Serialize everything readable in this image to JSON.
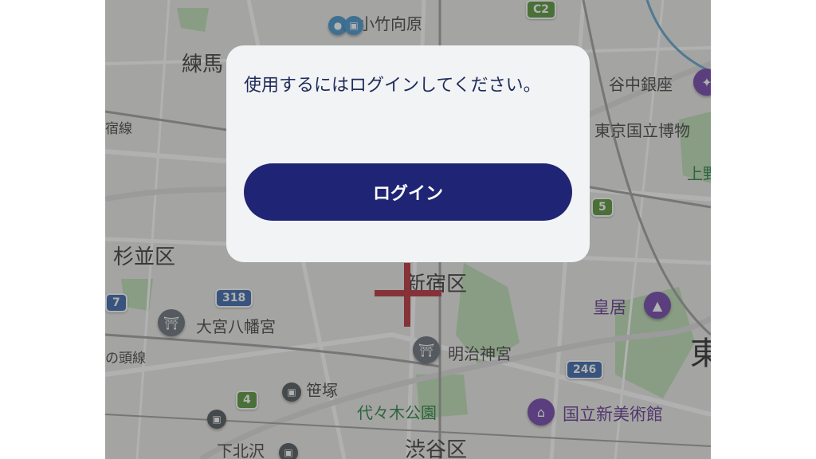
{
  "dialog": {
    "message": "使用するにはログインしてください。",
    "login_button": "ログイン"
  },
  "map": {
    "labels": {
      "kotake": "小竹向原",
      "nerima": "練馬",
      "yanaka": "谷中銀座",
      "tokyo_museum": "東京国立博物",
      "ueno": "上野",
      "line_left": "宿線",
      "suginami": "杉並区",
      "shinjuku": "新宿区",
      "omiya": "大宮八幡宮",
      "kokyo": "皇居",
      "meiji": "明治神宮",
      "higashi": "東",
      "kashira": "の頭線",
      "sasazuka": "笹塚",
      "yoyogi": "代々木公園",
      "kokuritsu": "国立新美術館",
      "shimokita": "下北沢",
      "shibuya": "渋谷区"
    },
    "shields": {
      "c2": "C2",
      "r5": "5",
      "r318": "318",
      "r7": "7",
      "r246": "246",
      "r4": "4"
    }
  },
  "colors": {
    "dialog_bg": "#f1f3f4",
    "button_bg": "#1f2574",
    "message_text": "#1f2a5a",
    "crosshair": "#b3272f",
    "park_green": "#a9d6a0"
  },
  "icons": {
    "shrine": "shrine-icon",
    "museum": "museum-icon",
    "palace": "palace-icon",
    "station": "train-station-icon"
  }
}
